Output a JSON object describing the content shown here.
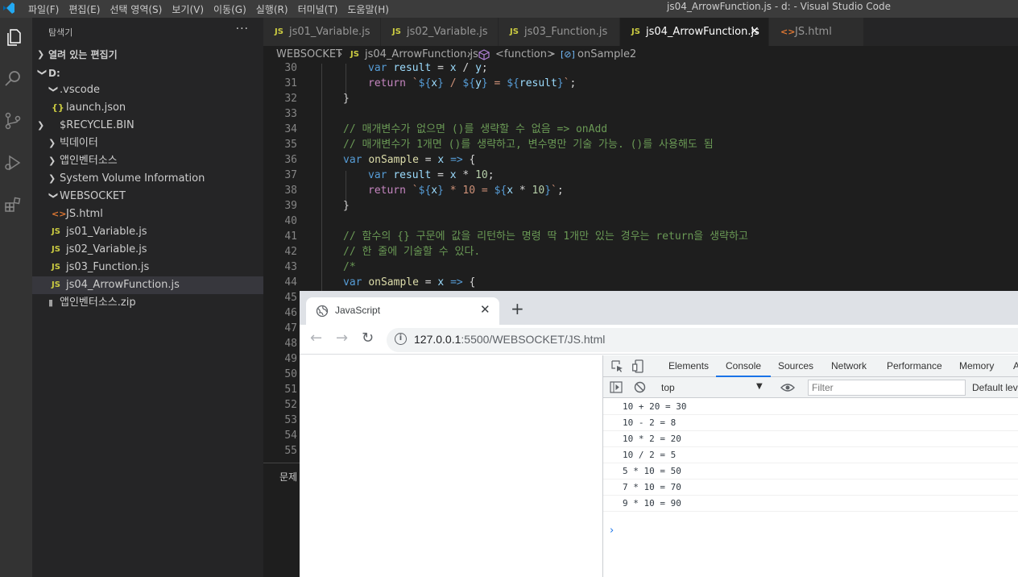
{
  "titlebar": {
    "menu": [
      "파일(F)",
      "편집(E)",
      "선택 영역(S)",
      "보기(V)",
      "이동(G)",
      "실행(R)",
      "터미널(T)",
      "도움말(H)"
    ],
    "window_title": "js04_ArrowFunction.js - d: - Visual Studio Code"
  },
  "sidebar": {
    "header": "탐색기",
    "more": "···",
    "open_editors": "열려 있는 편집기",
    "root": "D:",
    "items": [
      {
        "label": ".vscode",
        "type": "folder-open"
      },
      {
        "label": "launch.json",
        "type": "json"
      },
      {
        "label": "$RECYCLE.BIN",
        "type": "folder"
      },
      {
        "label": "빅데이터",
        "type": "folder"
      },
      {
        "label": "앱인벤터소스",
        "type": "folder"
      },
      {
        "label": "System Volume Information",
        "type": "folder"
      },
      {
        "label": "WEBSOCKET",
        "type": "folder-open"
      },
      {
        "label": "JS.html",
        "type": "html"
      },
      {
        "label": "js01_Variable.js",
        "type": "js"
      },
      {
        "label": "js02_Variable.js",
        "type": "js"
      },
      {
        "label": "js03_Function.js",
        "type": "js"
      },
      {
        "label": "js04_ArrowFunction.js",
        "type": "js"
      },
      {
        "label": "앱인벤터소스.zip",
        "type": "zip"
      }
    ]
  },
  "tabs": [
    {
      "label": "js01_Variable.js",
      "icon": "JS"
    },
    {
      "label": "js02_Variable.js",
      "icon": "JS"
    },
    {
      "label": "js03_Function.js",
      "icon": "JS"
    },
    {
      "label": "js04_ArrowFunction.js",
      "icon": "JS",
      "active": true
    },
    {
      "label": "JS.html",
      "icon": "<>"
    }
  ],
  "breadcrumbs": [
    "WEBSOCKET",
    "js04_ArrowFunction.js",
    "<function>",
    "onSample2"
  ],
  "editor": {
    "line_numbers": [
      "30",
      "31",
      "32",
      "33",
      "34",
      "35",
      "36",
      "37",
      "38",
      "39",
      "40",
      "41",
      "42",
      "43",
      "44",
      "45",
      "46",
      "47",
      "48",
      "49",
      "50",
      "51",
      "52",
      "53",
      "54",
      "55"
    ],
    "comments": {
      "c34": "// 매개변수가 없으면 ()를 생략할 수 없음 => onAdd",
      "c35": "// 매개변수가 1개면 ()를 생략하고, 변수명만 기술 가능. ()를 사용해도 됨",
      "c41": "// 함수의 {} 구문에 값을 리턴하는 명령 딱 1개만 있는 경우는 return을 생략하고",
      "c42": "// 한 줄에 기술할 수 있다.",
      "c43": "/*"
    },
    "panel_tab": "문제"
  },
  "browser": {
    "tab_title": "JavaScript",
    "url_host": "127.0.0.1",
    "url_rest": ":5500/WEBSOCKET/JS.html",
    "devtools_tabs": [
      "Elements",
      "Console",
      "Sources",
      "Network",
      "Performance",
      "Memory",
      "A"
    ],
    "context": "top",
    "filter_placeholder": "Filter",
    "levels": "Default lev",
    "console": [
      "10 + 20 = 30",
      "10 - 2 = 8",
      "10 * 2 = 20",
      "10 / 2 = 5",
      "5 * 10 = 50",
      "7 * 10 = 70",
      "9 * 10 = 90"
    ],
    "prompt": "›"
  }
}
